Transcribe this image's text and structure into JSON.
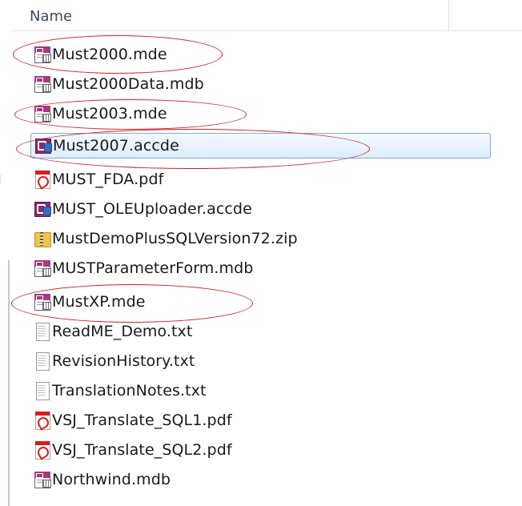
{
  "header": {
    "name_label": "Name"
  },
  "files": [
    {
      "name": "Must2000.mde",
      "icon": "access-database-icon"
    },
    {
      "name": "Must2000Data.mdb",
      "icon": "access-database-icon"
    },
    {
      "name": "Must2003.mde",
      "icon": "access-database-icon"
    },
    {
      "name": "Must2007.accde",
      "icon": "access-accde-icon"
    },
    {
      "name": "MUST_FDA.pdf",
      "icon": "pdf-icon"
    },
    {
      "name": "MUST_OLEUploader.accde",
      "icon": "access-accde-icon"
    },
    {
      "name": "MustDemoPlusSQLVersion72.zip",
      "icon": "zip-icon"
    },
    {
      "name": "MUSTParameterForm.mdb",
      "icon": "access-database-icon"
    },
    {
      "name": "MustXP.mde",
      "icon": "access-database-icon"
    },
    {
      "name": "ReadME_Demo.txt",
      "icon": "text-file-icon"
    },
    {
      "name": "RevisionHistory.txt",
      "icon": "text-file-icon"
    },
    {
      "name": "TranslationNotes.txt",
      "icon": "text-file-icon"
    },
    {
      "name": "VSJ_Translate_SQL1.pdf",
      "icon": "pdf-icon"
    },
    {
      "name": "VSJ_Translate_SQL2.pdf",
      "icon": "pdf-icon"
    },
    {
      "name": "Northwind.mdb",
      "icon": "access-database-icon"
    }
  ],
  "selected_file": "Must2007.accde",
  "annotation_color": "#d52222",
  "selection_color": "#dcedfc"
}
